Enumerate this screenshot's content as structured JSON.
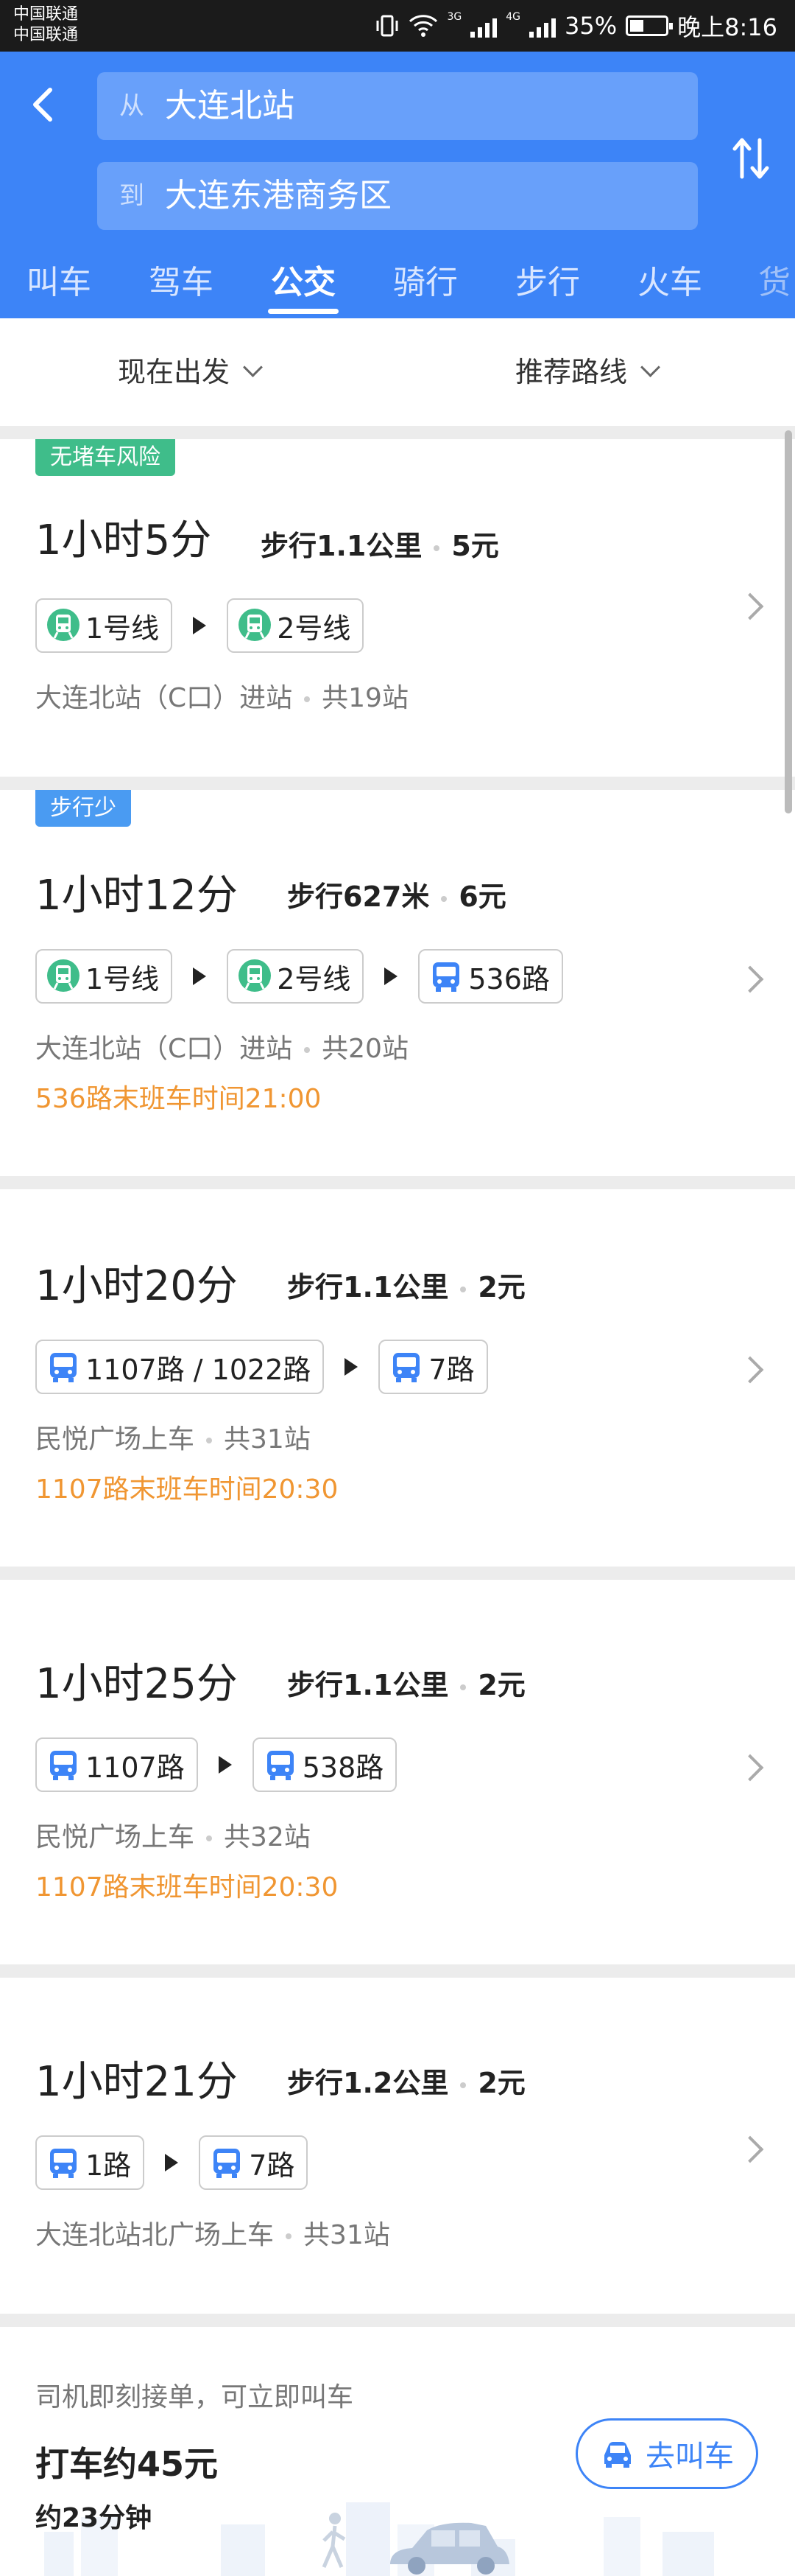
{
  "status_bar": {
    "carrier_1": "中国联通",
    "carrier_2": "中国联通",
    "net_1": "3G",
    "net_2": "4G",
    "battery": "35%",
    "time": "晚上8:16"
  },
  "header": {
    "from_prefix": "从",
    "from_value": "大连北站",
    "to_prefix": "到",
    "to_value": "大连东港商务区",
    "tabs": [
      "叫车",
      "驾车",
      "公交",
      "骑行",
      "步行",
      "火车",
      "货"
    ],
    "active_tab": "公交",
    "accent_color": "#3d84f7"
  },
  "filters": {
    "depart": "现在出发",
    "sort": "推荐路线"
  },
  "routes": [
    {
      "badge": "无堵车风险",
      "duration": "1小时5分",
      "walk": "步行1.1公里",
      "price": "5元",
      "segments": [
        {
          "icon": "subway-icon",
          "label": "1号线"
        },
        {
          "icon": "subway-icon",
          "label": "2号线"
        }
      ],
      "info": "大连北站（C口）进站",
      "stops": "共19站"
    },
    {
      "badge": "步行少",
      "duration": "1小时12分",
      "walk": "步行627米",
      "price": "6元",
      "segments": [
        {
          "icon": "subway-icon",
          "label": "1号线"
        },
        {
          "icon": "subway-icon",
          "label": "2号线"
        },
        {
          "icon": "bus-icon",
          "label": "536路"
        }
      ],
      "info": "大连北站（C口）进站",
      "stops": "共20站",
      "warning": "536路末班车时间21:00"
    },
    {
      "duration": "1小时20分",
      "walk": "步行1.1公里",
      "price": "2元",
      "segments": [
        {
          "icon": "bus-icon",
          "label": "1107路 / 1022路"
        },
        {
          "icon": "bus-icon",
          "label": "7路"
        }
      ],
      "info": "民悦广场上车",
      "stops": "共31站",
      "warning": "1107路末班车时间20:30"
    },
    {
      "duration": "1小时25分",
      "walk": "步行1.1公里",
      "price": "2元",
      "segments": [
        {
          "icon": "bus-icon",
          "label": "1107路"
        },
        {
          "icon": "bus-icon",
          "label": "538路"
        }
      ],
      "info": "民悦广场上车",
      "stops": "共32站",
      "warning": "1107路末班车时间20:30"
    },
    {
      "duration": "1小时21分",
      "walk": "步行1.2公里",
      "price": "2元",
      "segments": [
        {
          "icon": "bus-icon",
          "label": "1路"
        },
        {
          "icon": "bus-icon",
          "label": "7路"
        }
      ],
      "info": "大连北站北广场上车",
      "stops": "共31站"
    }
  ],
  "taxi": {
    "note": "司机即刻接单，可立即叫车",
    "price": "打车约45元",
    "time": "约23分钟",
    "button": "去叫车"
  },
  "colors": {
    "subway": "#3fbd8a",
    "bus": "#3d84f7",
    "warning": "#f09632"
  }
}
